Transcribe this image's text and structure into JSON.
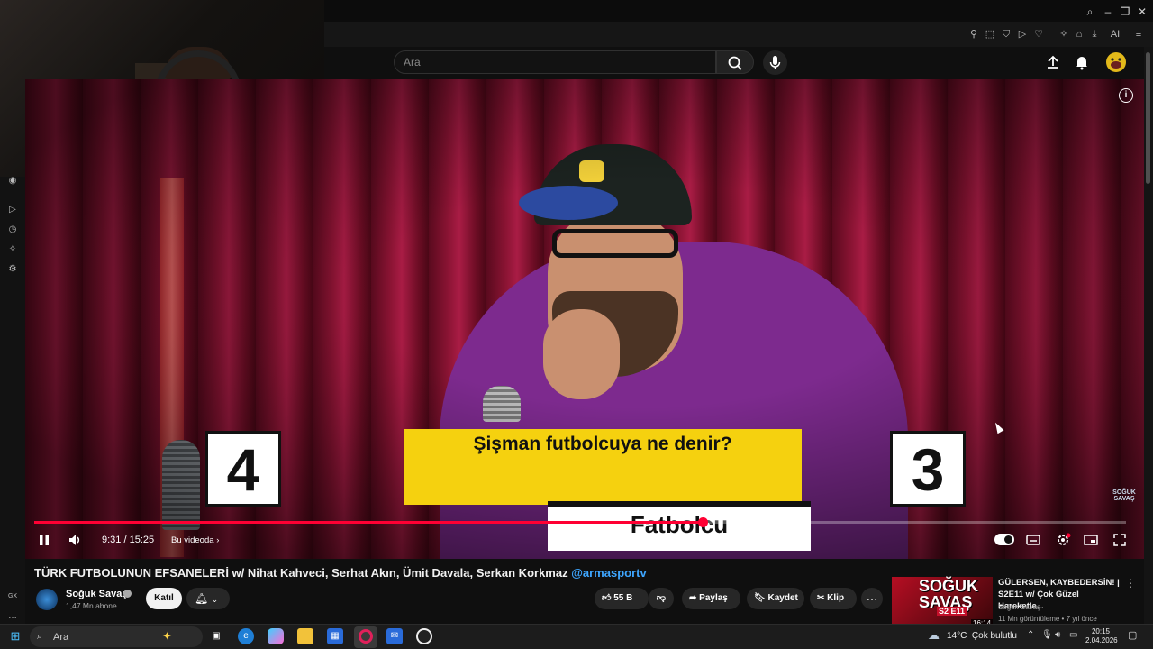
{
  "browser": {
    "search_placeholder": "Ara",
    "extension_badge": "AI"
  },
  "video": {
    "question": "Şişman futbolcuya ne denir?",
    "answer": "Fatbolcu",
    "score_left": "4",
    "score_right": "3",
    "watermark": "SOĞUK SAVAŞ",
    "time": "9:31 / 15:25",
    "chapter": "Bu videoda",
    "progress": 0.6118
  },
  "meta": {
    "title": "TÜRK FUTBOLUNUN EFSANELERİ w/ Nihat Kahveci, Serhat Akın, Ümit Davala, Serkan Korkmaz",
    "title_handle": "@armasportv",
    "channel_name": "Soğuk Savaş",
    "subscribers": "1,47 Mn abone",
    "join_label": "Katıl",
    "likes": "55 B",
    "share_label": "Paylaş",
    "save_label": "Kaydet",
    "clip_label": "Klip"
  },
  "recommendation": {
    "thumb_text_1": "SOĞUK",
    "thumb_text_2": "SAVAŞ",
    "thumb_badge": "S2 E11",
    "duration": "16:14",
    "title": "GÜLERSEN, KAYBEDERSİN! | S2E11 w/ Çok Güzel Hareketle...",
    "channel": "Soğuk Savaş",
    "stats": "11 Mn görüntüleme • 7 yıl önce"
  },
  "sidebar": {
    "gx_label": "GX"
  },
  "taskbar": {
    "search_text": "Ara",
    "temperature": "14°C",
    "weather": "Çok bulutlu",
    "time": "20:15",
    "date": "2.04.2026"
  },
  "colors": {
    "accent": "#ff0033",
    "question_bg": "#f5d10f",
    "link": "#3ea6ff"
  }
}
